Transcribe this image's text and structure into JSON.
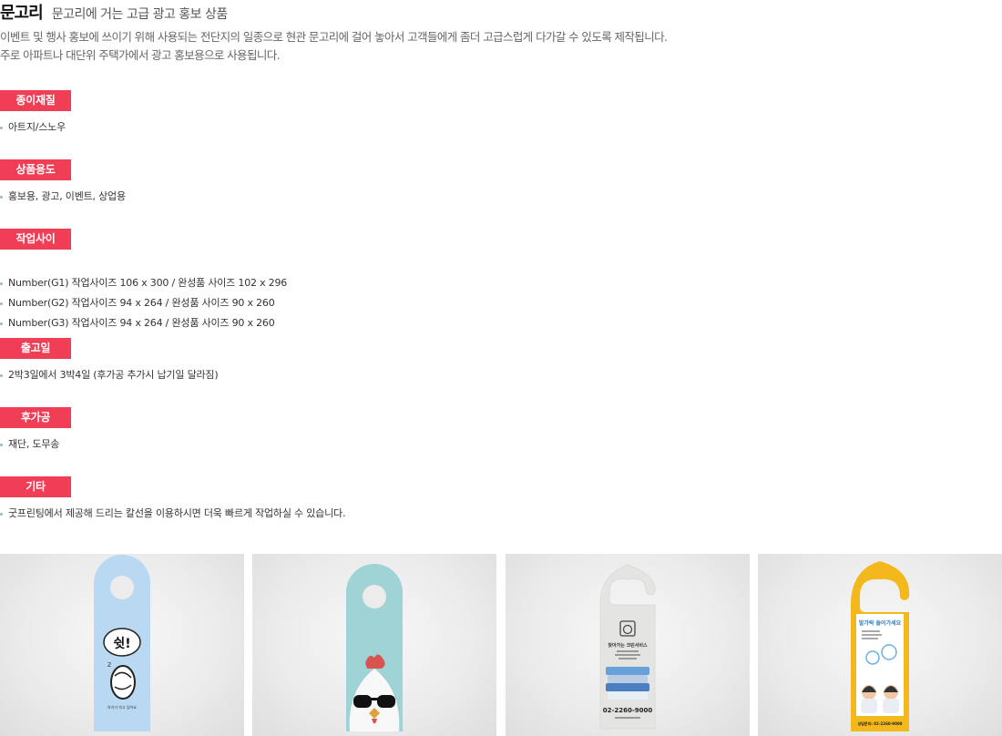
{
  "header": {
    "title": "문고리",
    "subtitle": "문고리에 거는 고급 광고 홍보 상품"
  },
  "description": [
    "이벤트 및 행사 홍보에 쓰이기 위해 사용되는 전단지의 일종으로 현관 문고리에 걸어 놓아서 고객들에게 좀더 고급스럽게 다가갈 수 있도록 제작됩니다.",
    "주로 아파트나 대단위 주택가에서 광고 홍보용으로 사용됩니다."
  ],
  "sections": [
    {
      "label": "종이재질",
      "items": [
        "아트지/스노우"
      ]
    },
    {
      "label": "상품용도",
      "items": [
        "홍보용, 광고, 이벤트, 상업용"
      ]
    },
    {
      "label": "작업사이즈",
      "items": [
        "Number(G1) 작업사이즈 106 x 300 / 완성품 사이즈 102 x 296",
        "Number(G2) 작업사이즈 94 x 264 / 완성품 사이즈 90 x 260",
        "Number(G3) 작업사이즈 94 x 264 / 완성품 사이즈 90 x 260"
      ]
    },
    {
      "label": "출고일",
      "items": [
        "2박3일에서 3박4일 (후가공 추가시 납기일 달라짐)"
      ]
    },
    {
      "label": "후가공",
      "items": [
        "재단, 도무송"
      ]
    },
    {
      "label": "기타",
      "items": [
        "굿프린팅에서 제공해 드리는 칼선을 이용하시면 더욱 빠르게 작업하실 수 있습니다."
      ]
    }
  ],
  "gallery": {
    "card1": {
      "bubble_text": "쉿!",
      "small_text": "아기가 자고 있어요",
      "color": "#b9d9f2"
    },
    "card2": {
      "color": "#9fd3d5"
    },
    "card3": {
      "service_name": "찾아가는 크린서비스",
      "phone": "02-2260-9000",
      "color": "#e4e4e2"
    },
    "card4": {
      "headline": "발가락 들어가세요",
      "footer_text": "상담문의: 02-2260-9000",
      "color": "#f3b81c"
    }
  }
}
